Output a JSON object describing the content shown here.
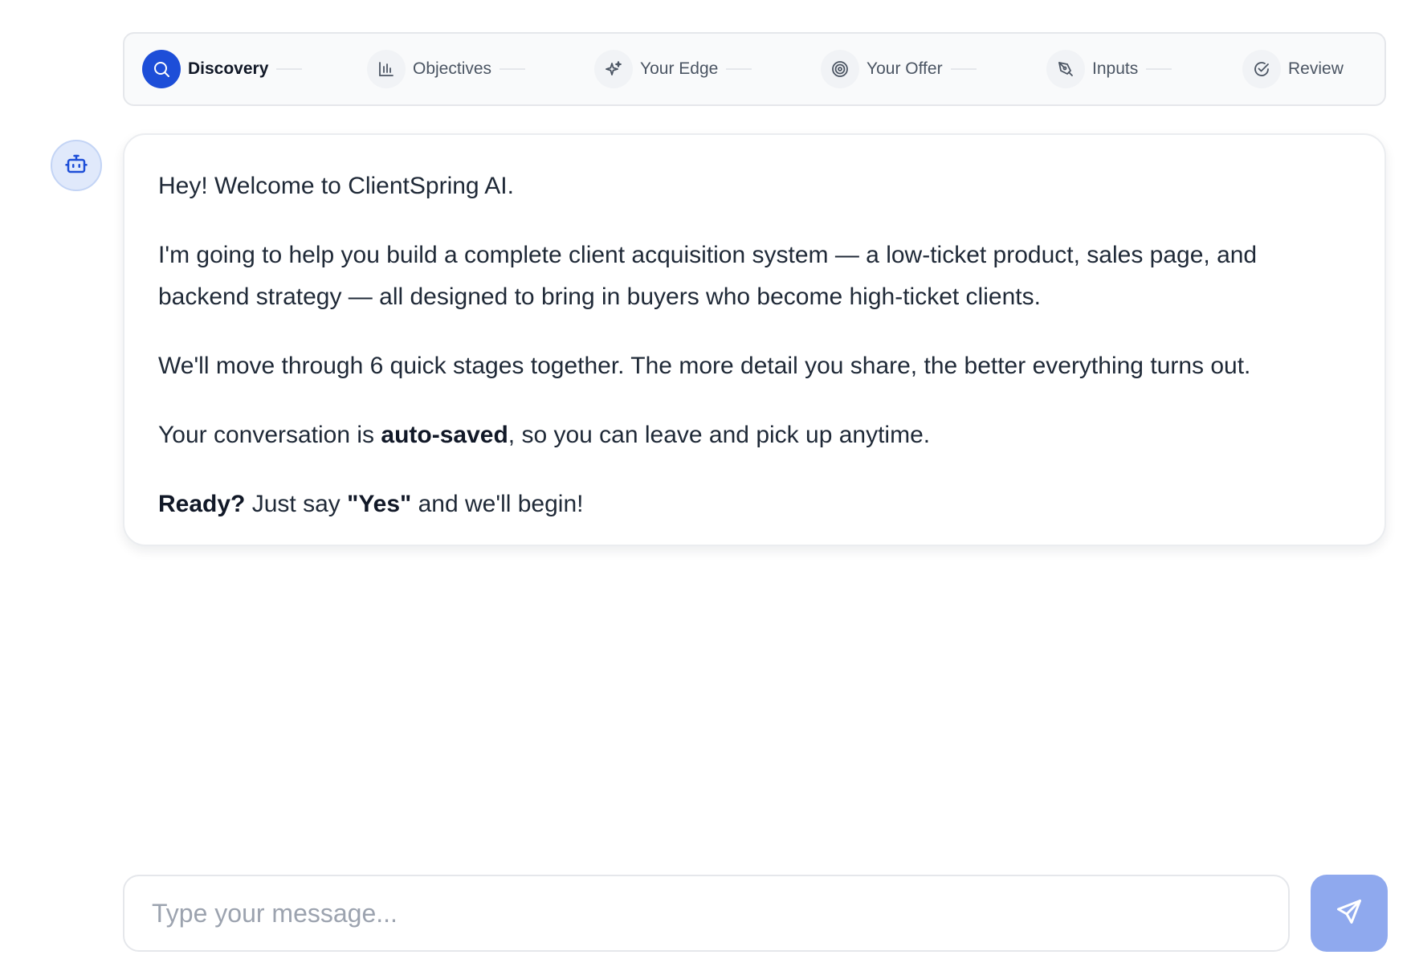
{
  "stepper": {
    "steps": [
      {
        "label": "Discovery",
        "icon": "search-icon",
        "active": true
      },
      {
        "label": "Objectives",
        "icon": "bar-chart-icon",
        "active": false
      },
      {
        "label": "Your Edge",
        "icon": "sparkles-icon",
        "active": false
      },
      {
        "label": "Your Offer",
        "icon": "target-icon",
        "active": false
      },
      {
        "label": "Inputs",
        "icon": "pen-tool-icon",
        "active": false
      },
      {
        "label": "Review",
        "icon": "check-circle-icon",
        "active": false
      }
    ]
  },
  "assistant": {
    "avatar_icon": "bot-icon",
    "message": {
      "p1": "Hey! Welcome to ClientSpring AI.",
      "p2": "I'm going to help you build a complete client acquisition system — a low-ticket product, sales page, and backend strategy — all designed to bring in buyers who become high-ticket clients.",
      "p3": "We'll move through 6 quick stages together. The more detail you share, the better everything turns out.",
      "p4_before": "Your conversation is ",
      "p4_bold": "auto-saved",
      "p4_after": ", so you can leave and pick up anytime.",
      "p5_bold1": "Ready?",
      "p5_mid": " Just say ",
      "p5_bold2": "\"Yes\"",
      "p5_after": " and we'll begin!"
    }
  },
  "composer": {
    "placeholder": "Type your message...",
    "value": "",
    "send_icon": "send-icon"
  },
  "colors": {
    "accent": "#1d4ed8",
    "send_button": "#8fa9ee",
    "avatar_bg": "#e0e9fb"
  }
}
